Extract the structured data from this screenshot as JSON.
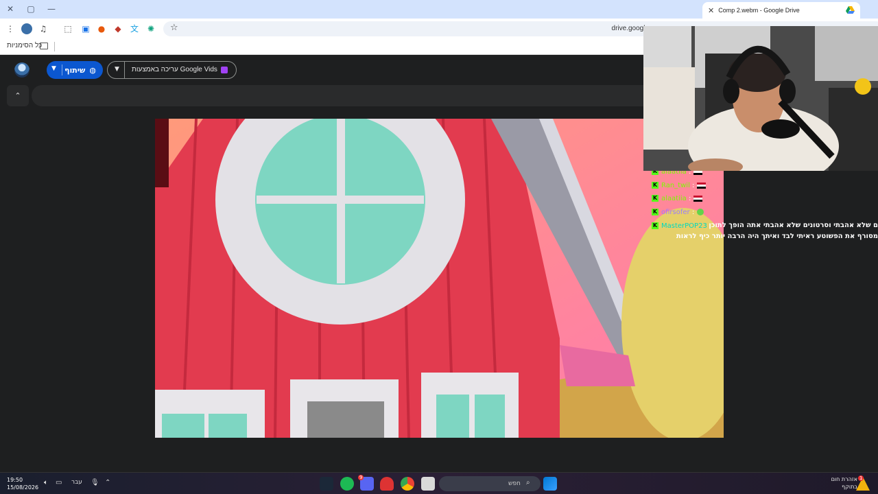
{
  "window": {
    "minimize": "—",
    "restore": "▢",
    "close": "✕"
  },
  "tab": {
    "title": "Comp 2.webm - Google Drive",
    "close": "✕",
    "new_tab": "+"
  },
  "address_bar": {
    "url": "drive.google"
  },
  "bookmarks": {
    "all_label": "כל הסימניות"
  },
  "viewer": {
    "share_label": "שיתוף",
    "edit_label": "עריכה באמצעות Google Vids"
  },
  "chat": {
    "lines": [
      {
        "user": "alaatiia",
        "color": "#7cfc00"
      },
      {
        "user": "Ran_twil",
        "color": "#7cfc00"
      },
      {
        "user": "alaatiia",
        "color": "#7cfc00"
      },
      {
        "user": "ofirsofer",
        "color": "#9b7bff"
      },
      {
        "user": "MasterPOP23",
        "color": "#00d9c0"
      }
    ],
    "message_line1": "ם שלא אהבתי וסרטונים שלא אהבתי אתה הופך לתוכן",
    "message_line2": "מסורף את הפשוטע ראיתי לבד ואיתך היה הרבה יותר כיף לראות"
  },
  "taskbar": {
    "time": "19:50",
    "date": "15/08/2026",
    "language": "עבר",
    "search_placeholder": "חפש",
    "weather_line1": "אזהרת חום",
    "weather_line2": "בתוקף",
    "notification_count": "1",
    "discord_badge": "9"
  }
}
